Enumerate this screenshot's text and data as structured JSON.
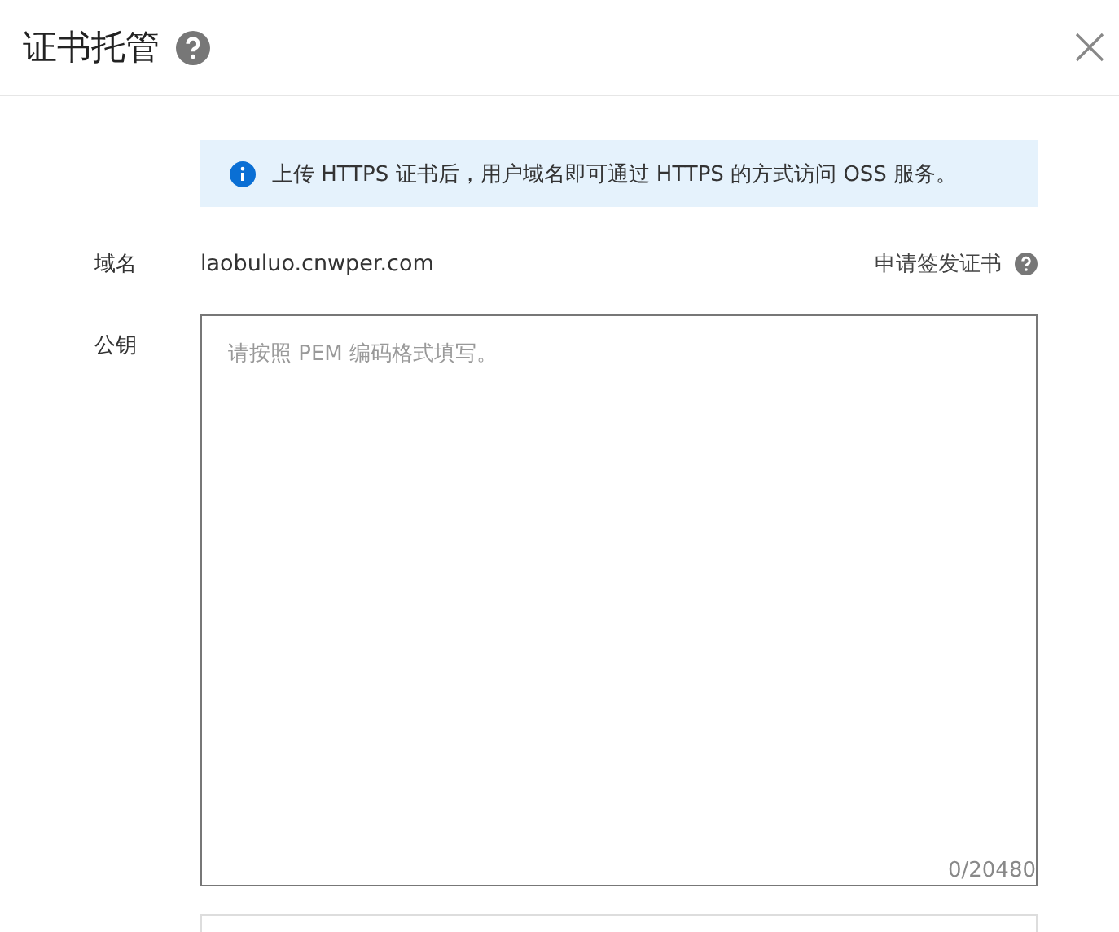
{
  "dialog": {
    "title": "证书托管"
  },
  "notice": {
    "text": "上传 HTTPS 证书后，用户域名即可通过 HTTPS 的方式访问 OSS 服务。"
  },
  "domain": {
    "label": "域名",
    "value": "laobuluo.cnwper.com",
    "link": "申请签发证书"
  },
  "public_key": {
    "label": "公钥",
    "placeholder": "请按照 PEM 编码格式填写。",
    "counter": "0/20480"
  }
}
